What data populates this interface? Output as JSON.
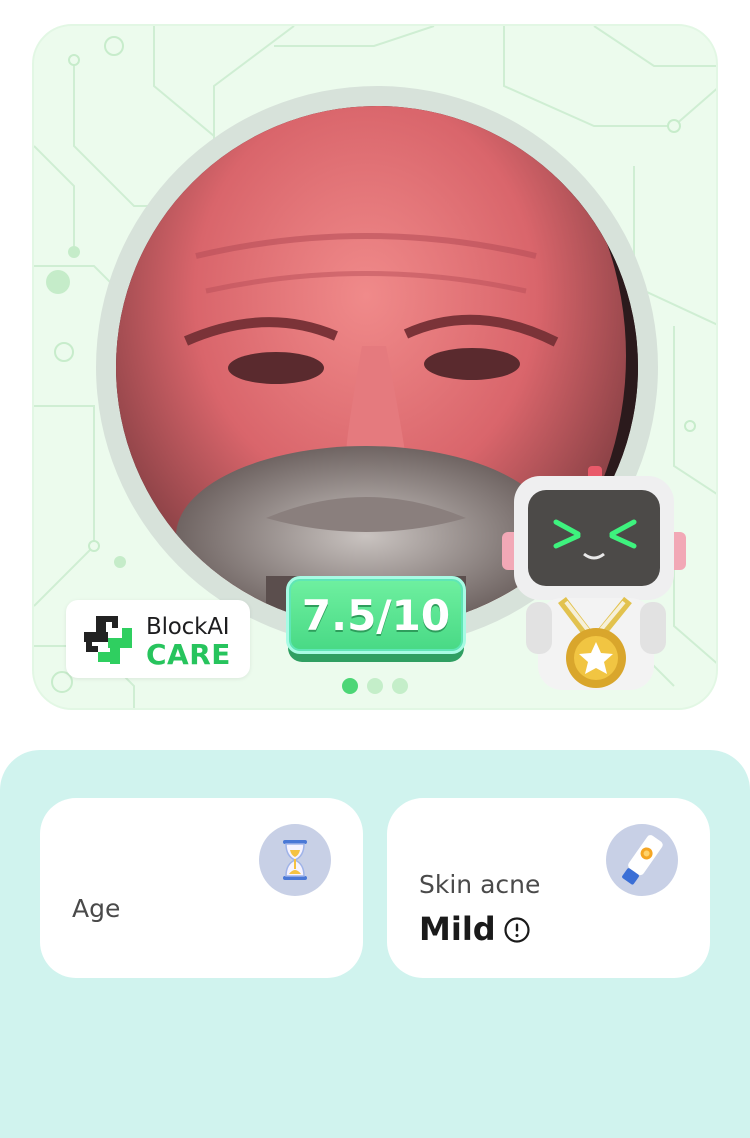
{
  "result": {
    "score": "7.5/10",
    "carousel": {
      "count": 3,
      "active": 0
    }
  },
  "brand": {
    "name_line1": "BlockAI",
    "name_line2": "CARE",
    "accent_color": "#27c45d"
  },
  "metrics": [
    {
      "label": "Age",
      "value": "",
      "icon": "hourglass-icon"
    },
    {
      "label": "Skin acne",
      "value": "Mild",
      "icon": "sunscreen-tube-icon",
      "has_info": true
    }
  ],
  "colors": {
    "hero_bg": "#ecfbed",
    "panel_bg": "#d0f3ee",
    "score_green": "#48d985",
    "icon_circle": "#c8d0e6"
  }
}
